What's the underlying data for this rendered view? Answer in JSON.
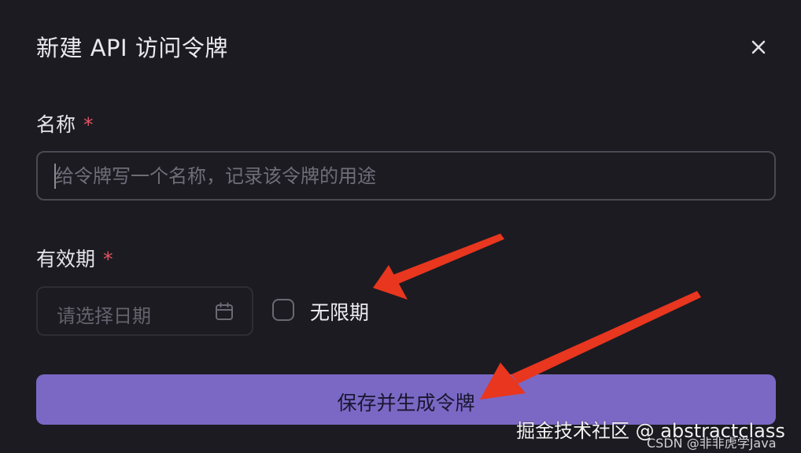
{
  "dialog": {
    "title": "新建 API 访问令牌",
    "close_icon": "close-icon"
  },
  "name_field": {
    "label": "名称",
    "required_mark": "*",
    "value": "",
    "placeholder": "给令牌写一个名称，记录该令牌的用途"
  },
  "expiry_field": {
    "label": "有效期",
    "required_mark": "*",
    "date_placeholder": "请选择日期",
    "calendar_icon": "calendar-icon",
    "no_expiry_label": "无限期",
    "no_expiry_checked": false
  },
  "submit": {
    "label": "保存并生成令牌"
  },
  "watermark": {
    "main": "掘金技术社区 @ abstractclass",
    "sub": "CSDN @非非虎学Java"
  },
  "colors": {
    "background": "#1c1b22",
    "primary": "#7b68c4",
    "required": "#e25561",
    "annotation_arrow": "#e8361f"
  }
}
